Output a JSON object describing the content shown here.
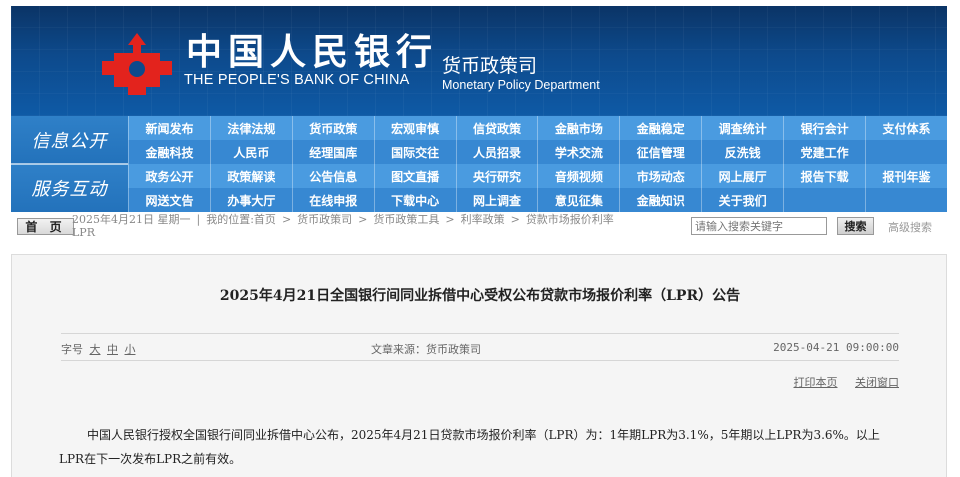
{
  "header": {
    "cn_name": "中国人民银行",
    "en_name": "THE PEOPLE'S BANK OF CHINA",
    "dept_cn": "货币政策司",
    "dept_en": "Monetary Policy Department",
    "logo_color": "#e3231d"
  },
  "nav": {
    "block1": "信息公开",
    "block2": "服务互动",
    "row1": [
      "新闻发布",
      "法律法规",
      "货币政策",
      "宏观审慎",
      "信贷政策",
      "金融市场",
      "金融稳定",
      "调查统计",
      "银行会计",
      "支付体系"
    ],
    "row2": [
      "金融科技",
      "人民币",
      "经理国库",
      "国际交往",
      "人员招录",
      "学术交流",
      "征信管理",
      "反洗钱",
      "党建工作",
      ""
    ],
    "row3": [
      "政务公开",
      "政策解读",
      "公告信息",
      "图文直播",
      "央行研究",
      "音频视频",
      "市场动态",
      "网上展厅",
      "报告下载",
      "报刊年鉴"
    ],
    "row4": [
      "网送文告",
      "办事大厅",
      "在线申报",
      "下载中心",
      "网上调查",
      "意见征集",
      "金融知识",
      "关于我们",
      "",
      ""
    ]
  },
  "crumbbar": {
    "home": "首 页",
    "date_label": "2025年4月21日 星期一",
    "location": "我的位置:首页",
    "crumbs": [
      "货币政策司",
      "货币政策工具",
      "利率政策",
      "贷款市场报价利率"
    ],
    "crumb_tail": "LPR",
    "search_placeholder": "请输入搜索关键字",
    "search_button": "搜索",
    "advanced": "高级搜索"
  },
  "article": {
    "title": "2025年4月21日全国银行间同业拆借中心受权公布贷款市场报价利率（LPR）公告",
    "font_label": "字号",
    "font_sizes": [
      "大",
      "中",
      "小"
    ],
    "source": "文章来源：货币政策司",
    "date": "2025-04-21 09:00:00",
    "print": "打印本页",
    "close": "关闭窗口",
    "body": "中国人民银行授权全国银行间同业拆借中心公布，2025年4月21日贷款市场报价利率（LPR）为：1年期LPR为3.1%，5年期以上LPR为3.6%。以上LPR在下一次发布LPR之前有效。"
  }
}
